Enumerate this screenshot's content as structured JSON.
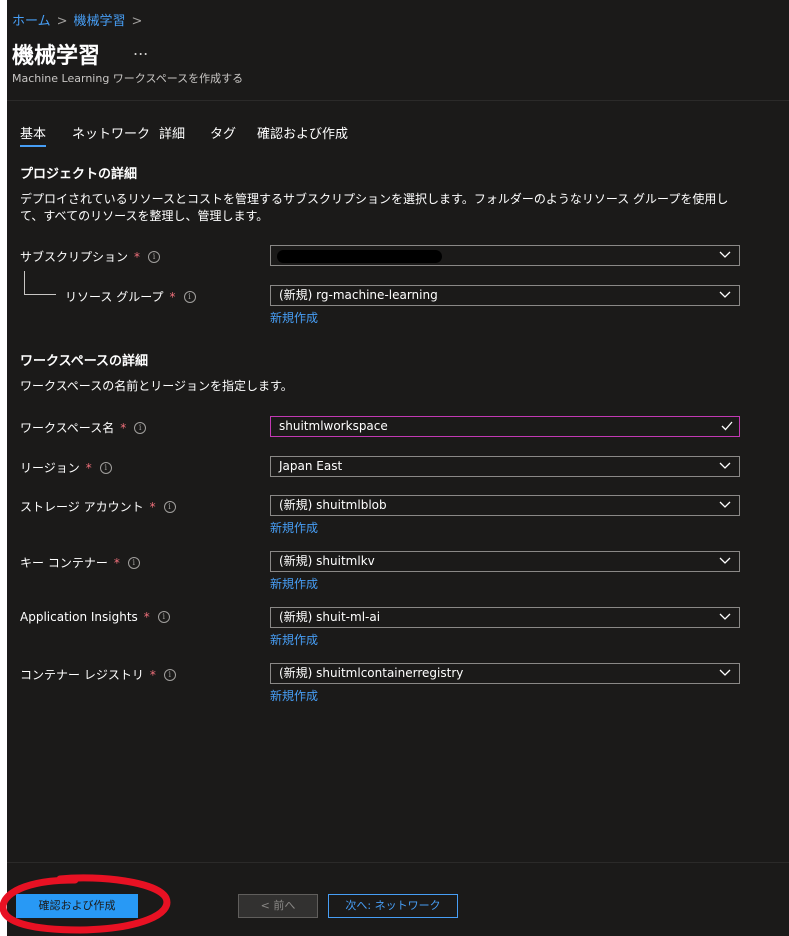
{
  "breadcrumb": {
    "home": "ホーム",
    "current": "機械学習",
    "separator": ">"
  },
  "header": {
    "title": "機械学習",
    "more_label": "...",
    "subtitle": "Machine Learning ワークスペースを作成する"
  },
  "tabs": [
    {
      "label": "基本",
      "active": true
    },
    {
      "label": "ネットワーク"
    },
    {
      "label": "詳細"
    },
    {
      "label": "タグ"
    },
    {
      "label": "確認および作成"
    }
  ],
  "project": {
    "title": "プロジェクトの詳細",
    "description": "デプロイされているリソースとコストを管理するサブスクリプションを選択します。フォルダーのようなリソース グループを使用して、すべてのリソースを整理し、管理します。",
    "subscription": {
      "label": "サブスクリプション",
      "value": ""
    },
    "resource_group": {
      "label": "リソース グループ",
      "value": "(新規) rg-machine-learning",
      "link": "新規作成"
    }
  },
  "workspace": {
    "title": "ワークスペースの詳細",
    "description": "ワークスペースの名前とリージョンを指定します。",
    "name": {
      "label": "ワークスペース名",
      "value": "shuitmlworkspace"
    },
    "region": {
      "label": "リージョン",
      "value": "Japan East"
    },
    "storage": {
      "label": "ストレージ アカウント",
      "value": "(新規) shuitmlblob",
      "link": "新規作成"
    },
    "keyvault": {
      "label": "キー コンテナー",
      "value": "(新規) shuitmlkv",
      "link": "新規作成"
    },
    "appinsights": {
      "label": "Application Insights",
      "value": "(新規) shuit-ml-ai",
      "link": "新規作成"
    },
    "registry": {
      "label": "コンテナー レジストリ",
      "value": "(新規) shuitmlcontainerregistry",
      "link": "新規作成"
    }
  },
  "required_mark": "*",
  "info_glyph": "i",
  "footer": {
    "review_create": "確認および作成",
    "previous": "< 前へ",
    "next": "次へ: ネットワーク"
  },
  "colors": {
    "background": "#1b1a19",
    "accent": "#479ef5",
    "primary_button": "#2899f5",
    "required": "#f1707b",
    "focus_border": "#c239b3",
    "annotation": "#e81123"
  }
}
